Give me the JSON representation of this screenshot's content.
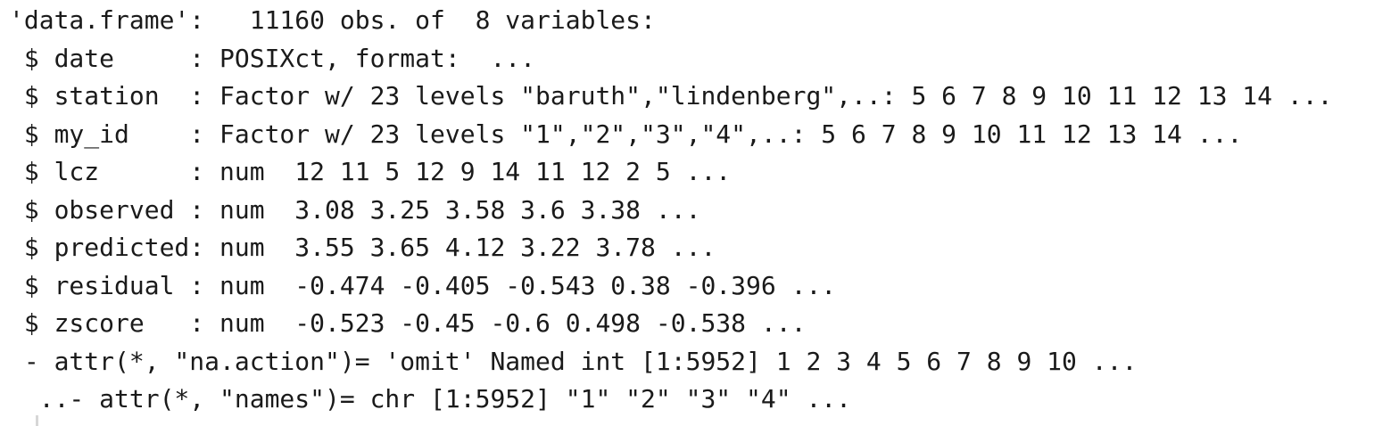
{
  "console": {
    "lines": [
      "'data.frame':\t11160 obs. of  8 variables:",
      " $ date     : POSIXct, format:  ...",
      " $ station  : Factor w/ 23 levels \"baruth\",\"lindenberg\",..: 5 6 7 8 9 10 11 12 13 14 ...",
      " $ my_id    : Factor w/ 23 levels \"1\",\"2\",\"3\",\"4\",..: 5 6 7 8 9 10 11 12 13 14 ...",
      " $ lcz      : num  12 11 5 12 9 14 11 12 2 5 ...",
      " $ observed : num  3.08 3.25 3.58 3.6 3.38 ...",
      " $ predicted: num  3.55 3.65 4.12 3.22 3.78 ...",
      " $ residual : num  -0.474 -0.405 -0.543 0.38 -0.396 ...",
      " $ zscore   : num  -0.523 -0.45 -0.6 0.498 -0.538 ...",
      " - attr(*, \"na.action\")= 'omit' Named int [1:5952] 1 2 3 4 5 6 7 8 9 10 ...",
      "  ..- attr(*, \"names\")= chr [1:5952] \"1\" \"2\" \"3\" \"4\" ..."
    ]
  }
}
